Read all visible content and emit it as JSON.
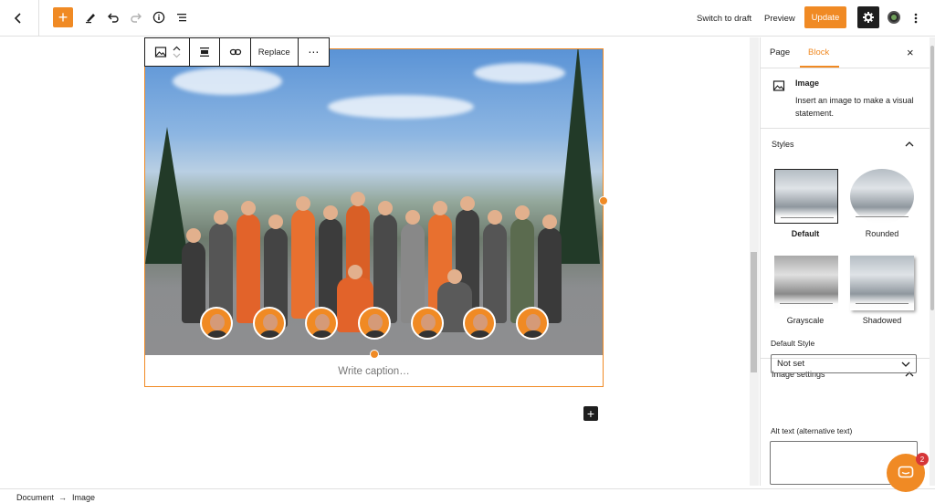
{
  "topbar": {
    "switch_to_draft": "Switch to draft",
    "preview": "Preview",
    "update": "Update",
    "add_symbol": "+"
  },
  "block_toolbar": {
    "replace": "Replace",
    "more": "⋯"
  },
  "image_block": {
    "caption_placeholder": "Write caption…"
  },
  "sidebar": {
    "tabs": [
      {
        "label": "Page",
        "active": false
      },
      {
        "label": "Block",
        "active": true
      }
    ],
    "close": "×",
    "block_card": {
      "title": "Image",
      "description": "Insert an image to make a visual statement."
    },
    "styles_panel": {
      "title": "Styles",
      "options": [
        {
          "label": "Default",
          "selected": true
        },
        {
          "label": "Rounded",
          "selected": false
        },
        {
          "label": "Grayscale",
          "selected": false
        },
        {
          "label": "Shadowed",
          "selected": false
        }
      ],
      "default_style_label": "Default Style",
      "default_style_value": "Not set"
    },
    "image_settings_panel": {
      "title": "Image settings",
      "alt_label": "Alt text (alternative text)"
    }
  },
  "chat": {
    "badge": "2"
  },
  "footer": {
    "breadcrumb": [
      "Document",
      "Image"
    ],
    "separator": "→"
  },
  "colors": {
    "accent": "#f08a24",
    "dark": "#1e1e1e",
    "badge": "#d63638"
  },
  "icons": [
    "back-chevron-icon",
    "plus-icon",
    "pen-icon",
    "undo-icon",
    "redo-icon",
    "info-icon",
    "list-view-icon",
    "gear-icon",
    "kebab-icon",
    "image-icon",
    "chevron-up-icon",
    "chevron-down-icon",
    "align-icon",
    "link-icon",
    "close-icon",
    "chat-icon"
  ]
}
